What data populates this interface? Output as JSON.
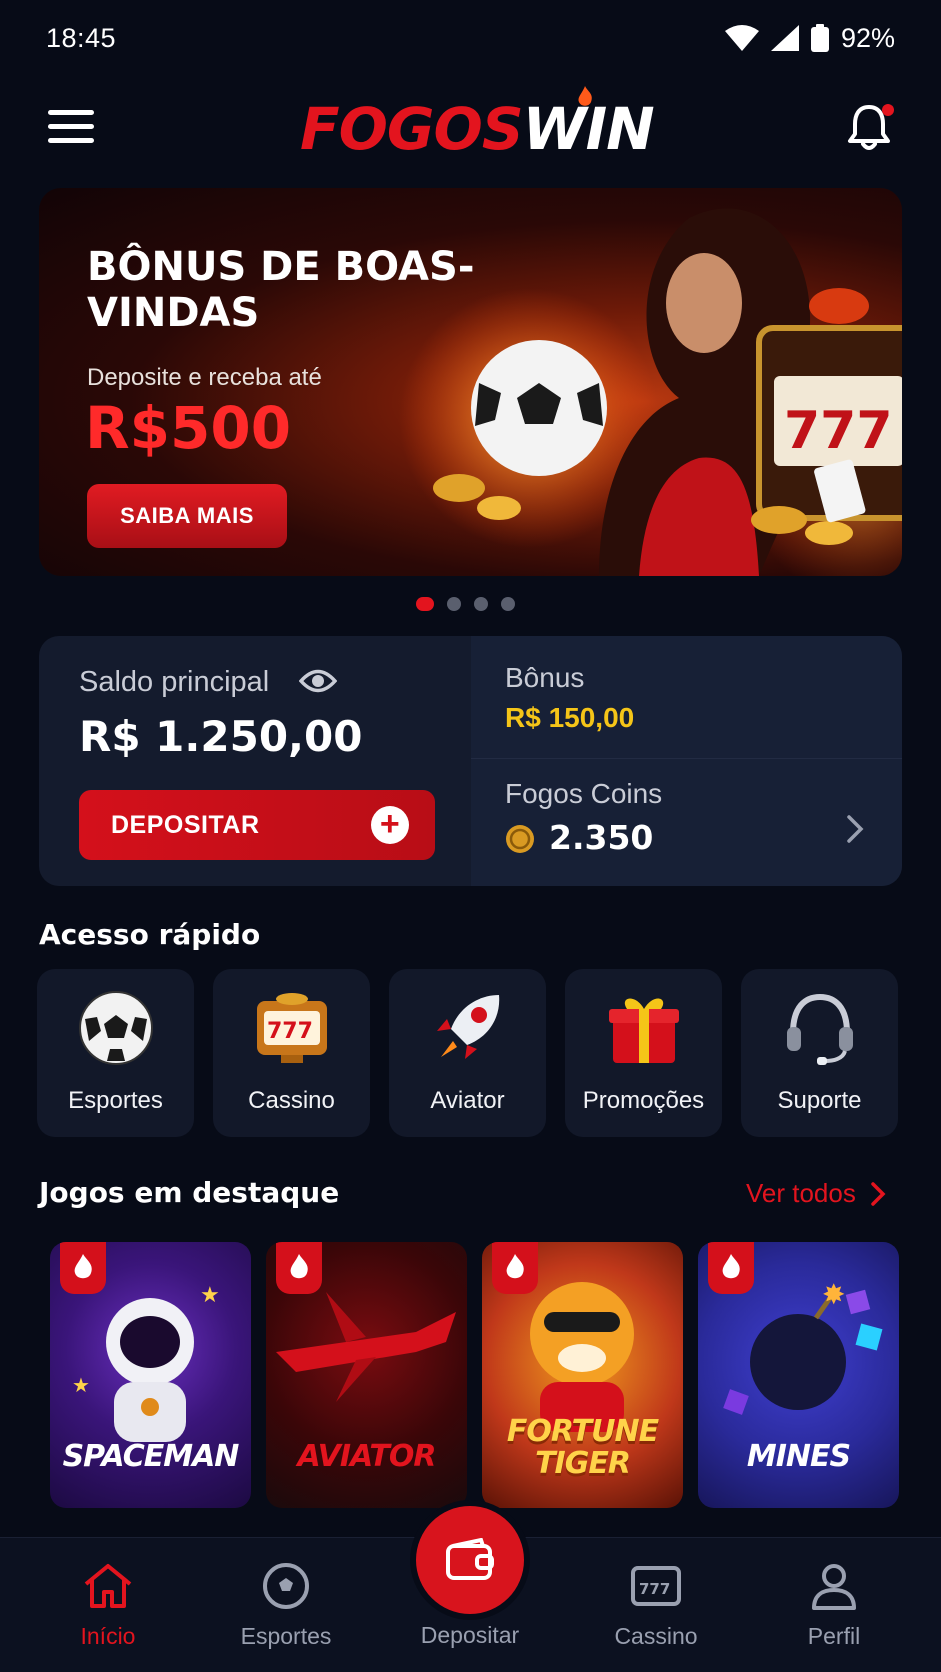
{
  "status_bar": {
    "time": "18:45",
    "battery": "92%",
    "icons": [
      "wifi-icon",
      "signal-icon",
      "battery-icon"
    ]
  },
  "header": {
    "logo_part1": "FOGOS",
    "logo_part2": "WIN",
    "menu_icon": "hamburger-menu-icon",
    "notification_icon": "bell-icon",
    "has_notification": true
  },
  "banner": {
    "title": "BÔNUS DE BOAS-VINDAS",
    "subtitle": "Deposite e receba até",
    "amount": "R$500",
    "cta": "SAIBA MAIS",
    "slides": 4,
    "active_slide": 1
  },
  "balance": {
    "main_label": "Saldo principal",
    "main_value": "R$ 1.250,00",
    "deposit_label": "DEPOSITAR",
    "bonus_label": "Bônus",
    "bonus_value": "R$ 150,00",
    "coins_label": "Fogos Coins",
    "coins_value": "2.350"
  },
  "quick_access": {
    "title": "Acesso rápido",
    "items": [
      {
        "label": "Esportes",
        "icon": "soccer-ball-icon"
      },
      {
        "label": "Cassino",
        "icon": "slot-machine-icon"
      },
      {
        "label": "Aviator",
        "icon": "rocket-icon"
      },
      {
        "label": "Promoções",
        "icon": "gift-icon"
      },
      {
        "label": "Suporte",
        "icon": "headset-icon"
      }
    ]
  },
  "featured": {
    "title": "Jogos em destaque",
    "see_all": "Ver todos",
    "games": [
      {
        "title": "SPACEMAN"
      },
      {
        "title": "AVIATOR"
      },
      {
        "title": "FORTUNE TIGER"
      },
      {
        "title": "MINES"
      }
    ]
  },
  "bottom_nav": {
    "items": [
      {
        "label": "Início",
        "icon": "home-icon",
        "active": true
      },
      {
        "label": "Esportes",
        "icon": "soccer-ball-icon",
        "active": false
      },
      {
        "label": "Depositar",
        "icon": "wallet-icon",
        "active": false
      },
      {
        "label": "Cassino",
        "icon": "slot-machine-icon",
        "active": false
      },
      {
        "label": "Perfil",
        "icon": "user-icon",
        "active": false
      }
    ]
  },
  "colors": {
    "accent": "#e3141e",
    "background": "#070b17",
    "card": "#141b2d",
    "gold": "#f5c518"
  }
}
